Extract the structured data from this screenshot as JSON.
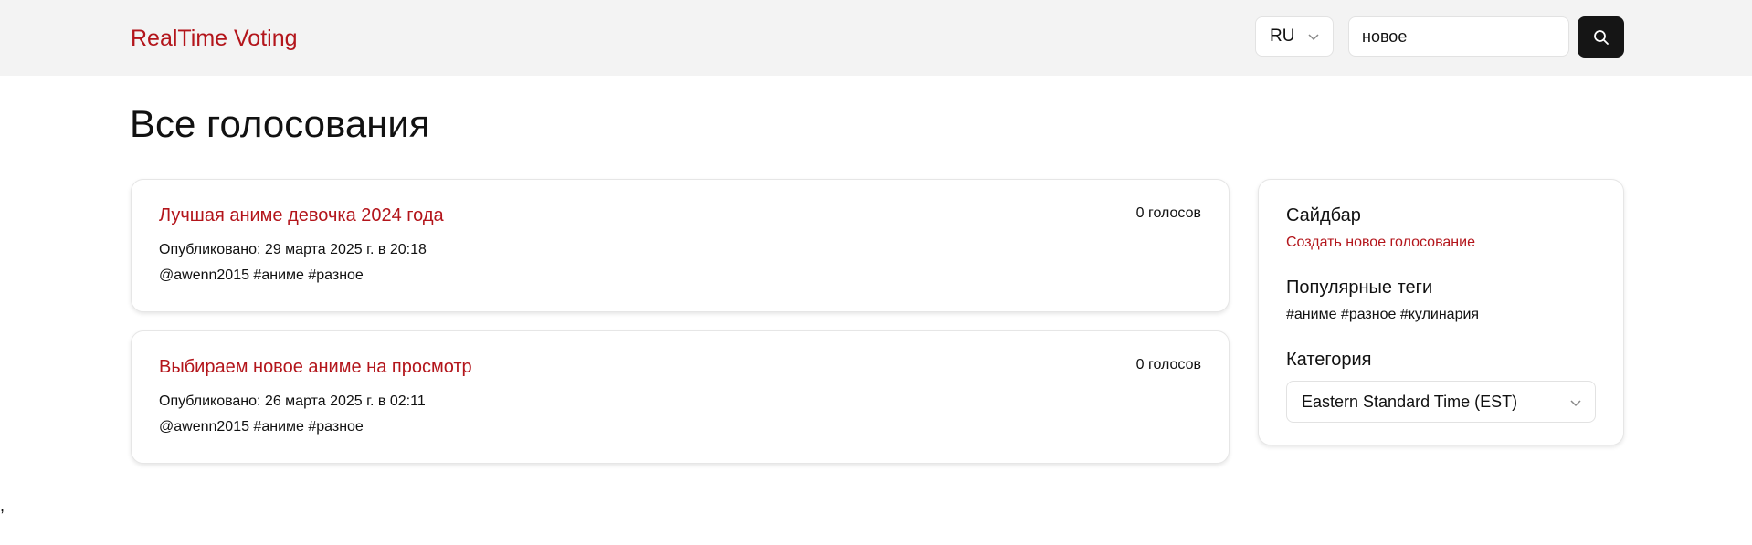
{
  "header": {
    "brand": "RealTime Voting",
    "language": "RU",
    "search": {
      "value": "новое",
      "placeholder": ""
    },
    "search_button_icon": "search-icon"
  },
  "main": {
    "title": "Все голосования",
    "polls": [
      {
        "title": "Лучшая аниме девочка 2024 года",
        "votes": "0 голосов",
        "published": "Опубликовано: 29 марта 2025 г. в 20:18",
        "meta": "@awenn2015 #аниме #разное"
      },
      {
        "title": "Выбираем новое аниме на просмотр",
        "votes": "0 голосов",
        "published": "Опубликовано: 26 марта 2025 г. в 02:11",
        "meta": "@awenn2015 #аниме #разное"
      }
    ]
  },
  "sidebar": {
    "title": "Сайдбар",
    "create_link": "Создать новое голосование",
    "popular_tags_title": "Популярные теги",
    "popular_tags": "#аниме #разное #кулинария",
    "category_title": "Категория",
    "category_value": "Eastern Standard Time (EST)"
  },
  "footer": {
    "stray_text": ","
  },
  "colors": {
    "accent": "#b3151b",
    "header_bg": "#f3f3f3",
    "search_button_bg": "#151515"
  }
}
